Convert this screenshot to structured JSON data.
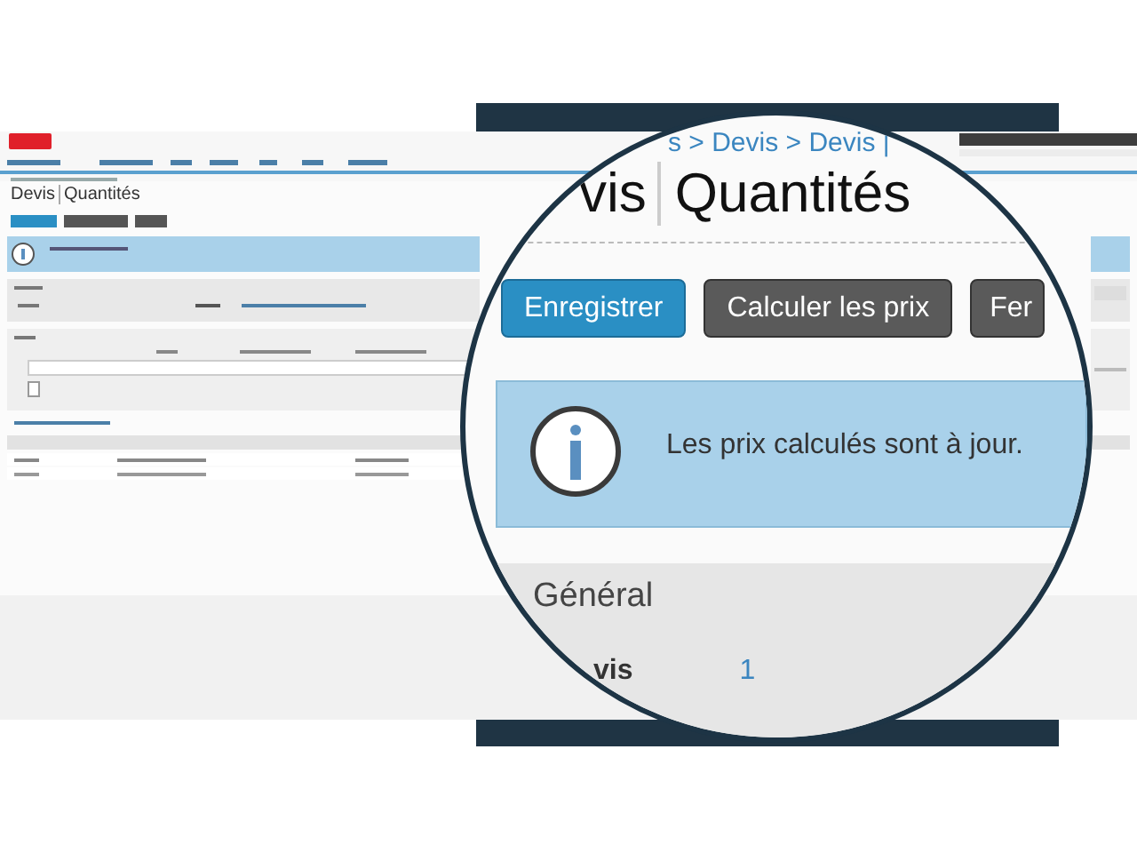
{
  "backdrop": {
    "title_prefix": "Devis",
    "title": "Quantités"
  },
  "magnifier": {
    "breadcrumb": "s > Devis > Devis |",
    "title_prefix": "vis",
    "title": "Quantités",
    "buttons": [
      {
        "label": "Enregistrer",
        "kind": "primary"
      },
      {
        "label": "Calculer les prix",
        "kind": "secondary"
      },
      {
        "label": "Fer",
        "kind": "secondary"
      }
    ],
    "info": {
      "message": "Les prix calculés sont à jour."
    },
    "section": {
      "title": "Général",
      "fields": [
        {
          "label": "vis",
          "value": "1"
        }
      ]
    }
  }
}
